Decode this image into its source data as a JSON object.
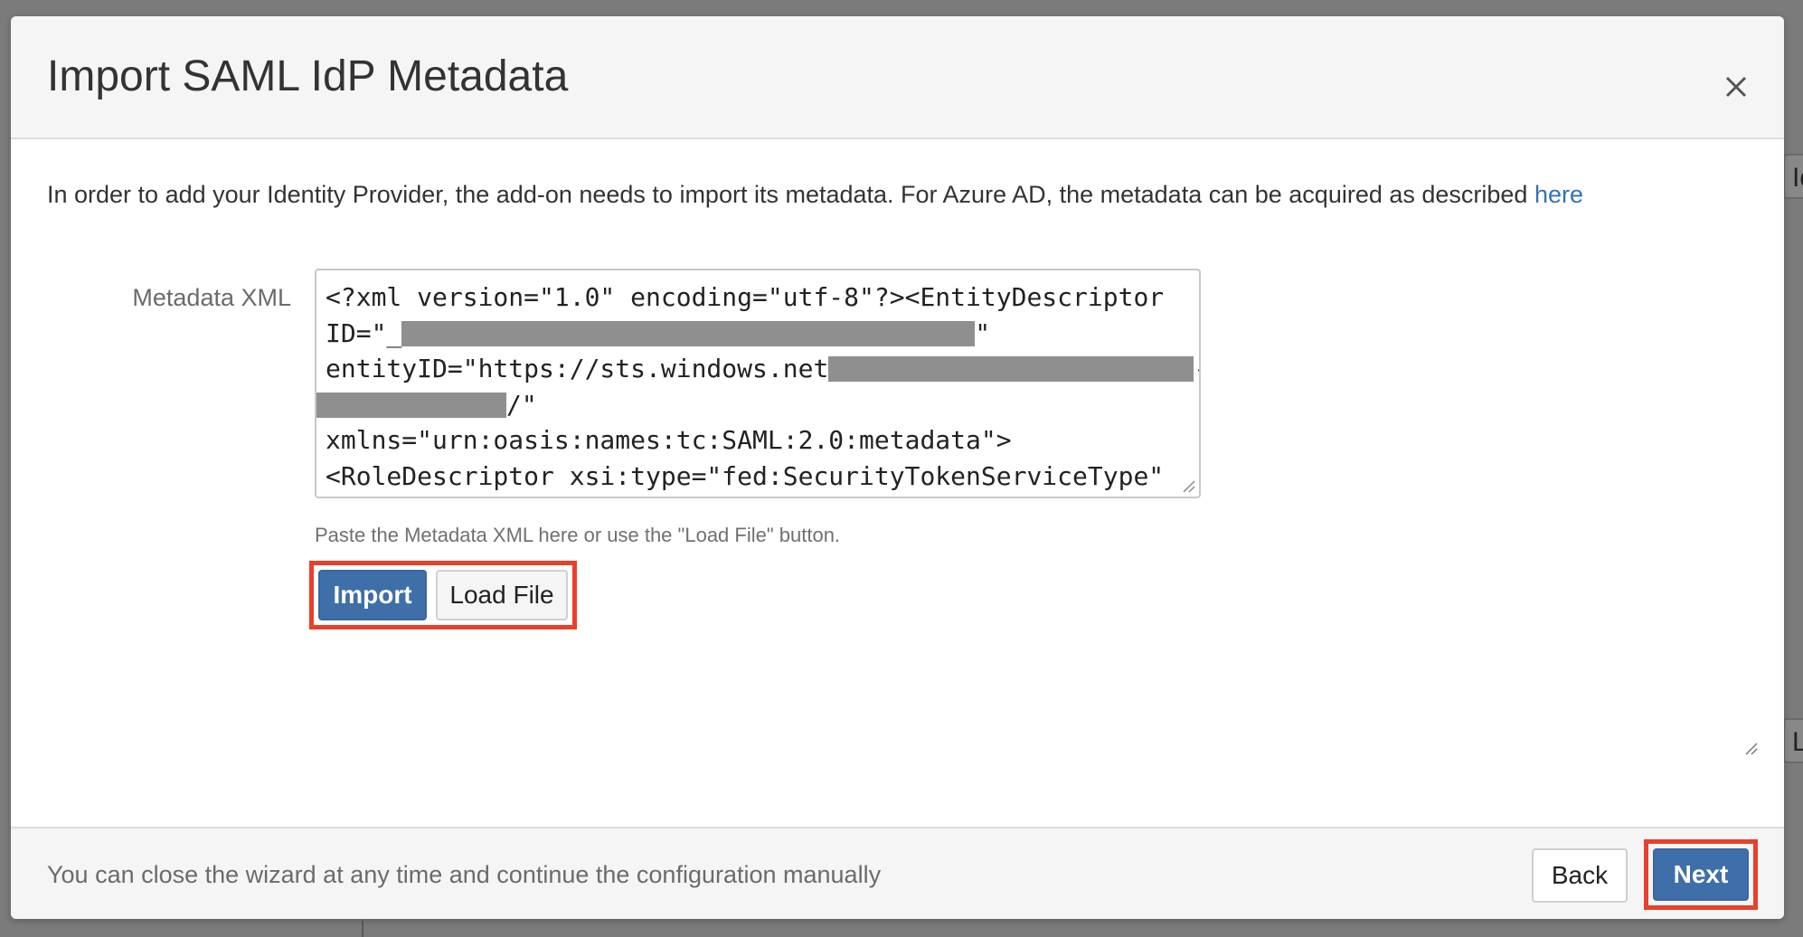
{
  "dialog": {
    "title": "Import SAML IdP Metadata",
    "intro_text": "In order to add your Identity Provider, the add-on needs to import its metadata. For Azure AD, the metadata can be acquired as described ",
    "intro_link": "here"
  },
  "metadata_field": {
    "label": "Metadata XML",
    "lines": {
      "l1": "<?xml version=\"1.0\" encoding=\"utf-8\"?><EntityDescriptor",
      "l2_pre": "ID=\"_",
      "l2_post": "\"",
      "l3_pre": "entityID=\"https://sts.windows.net",
      "l3_post": "-",
      "l4_post": "/\"",
      "l5": "xmlns=\"urn:oasis:names:tc:SAML:2.0:metadata\">",
      "l6": "<RoleDescriptor xsi:type=\"fed:SecurityTokenServiceType\""
    },
    "hint": "Paste the Metadata XML here or use the \"Load File\" button."
  },
  "buttons": {
    "import": "Import",
    "load_file": "Load File",
    "back": "Back",
    "next": "Next"
  },
  "footer": {
    "hint": "You can close the wizard at any time and continue the configuration manually"
  },
  "background": {
    "right_snippet_top": "Id",
    "right_snippet_bottom": "Lo"
  },
  "colors": {
    "primary": "#3f6fa8",
    "highlight": "#e8402a",
    "link": "#3572b0"
  }
}
